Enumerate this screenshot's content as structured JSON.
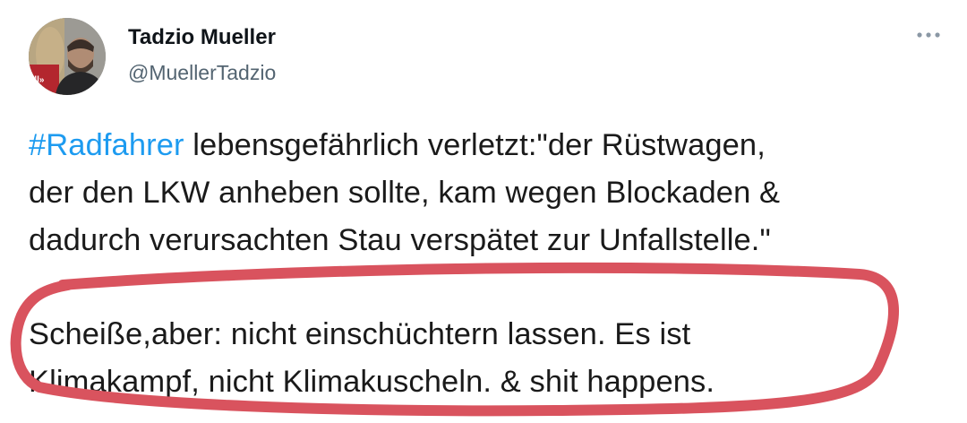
{
  "author": {
    "display_name": "Tadzio Mueller",
    "handle": "@MuellerTadzio"
  },
  "menu_icon": "more-horizontal-icon",
  "tweet": {
    "hashtag": "#Radfahrer",
    "paragraph1": {
      "line1_rest": " lebensgefährlich verletzt:\"der Rüstwagen,",
      "line2": "der den LKW anheben sollte, kam wegen Blockaden &",
      "line3": "dadurch verursachten Stau verspätet zur Unfallstelle.\""
    },
    "paragraph2": {
      "line1": "Scheiße,aber: nicht einschüchtern lassen. Es ist",
      "line2": "Klimakampf, nicht Klimakuscheln. & shit happens."
    }
  },
  "colors": {
    "hashtag": "#1d9bf0",
    "annotation_circle": "#d9535e",
    "handle": "#536471",
    "menu_dots": "#8b98a5"
  }
}
